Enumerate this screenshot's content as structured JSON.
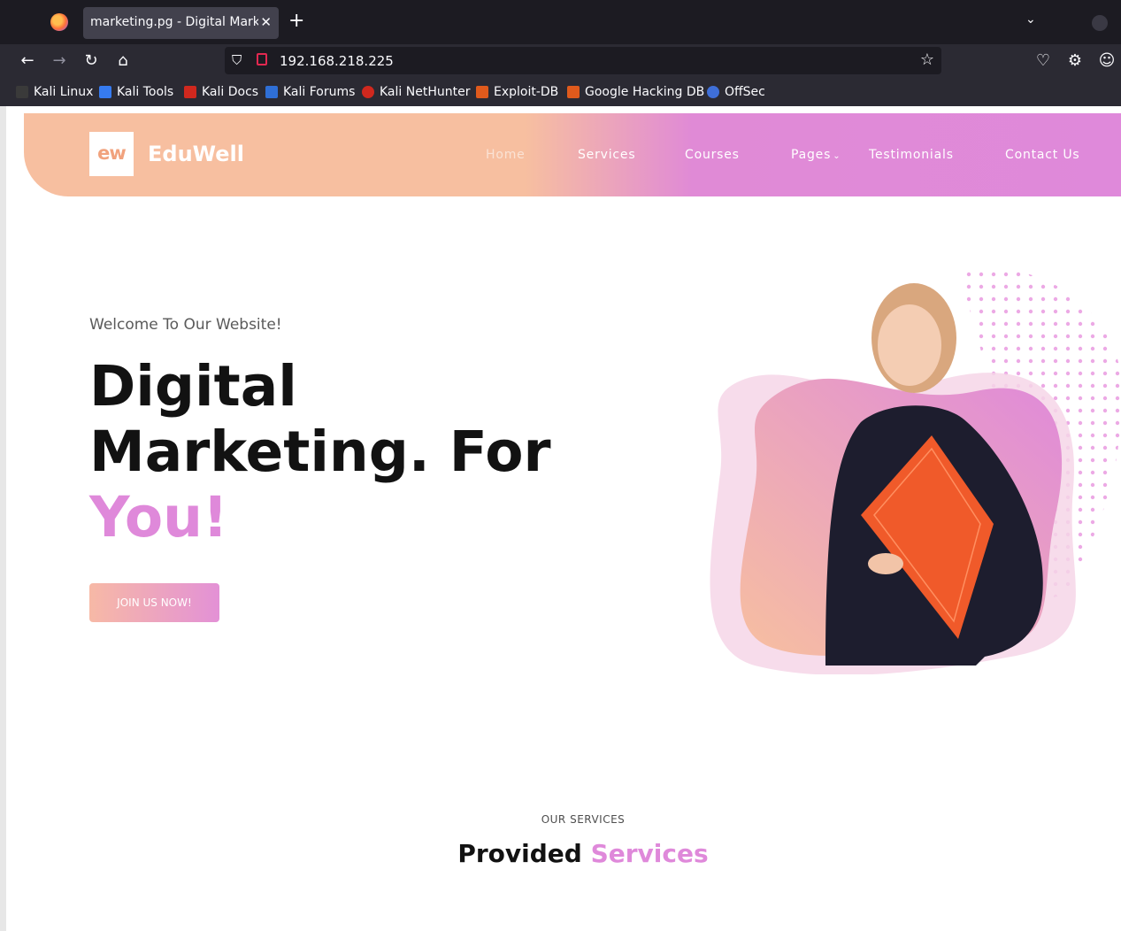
{
  "browser": {
    "tab_title": "marketing.pg - Digital Marketing",
    "new_tab_label": "+",
    "url": "192.168.218.225",
    "bookmarks": [
      {
        "label": "Kali Linux",
        "icon": "kali-dragon-icon"
      },
      {
        "label": "Kali Tools",
        "icon": "kali-tools-icon"
      },
      {
        "label": "Kali Docs",
        "icon": "kali-docs-icon"
      },
      {
        "label": "Kali Forums",
        "icon": "kali-forums-icon"
      },
      {
        "label": "Kali NetHunter",
        "icon": "nethunter-icon"
      },
      {
        "label": "Exploit-DB",
        "icon": "exploit-db-icon"
      },
      {
        "label": "Google Hacking DB",
        "icon": "ghdb-icon"
      },
      {
        "label": "OffSec",
        "icon": "offsec-icon"
      }
    ]
  },
  "site": {
    "logo_mark": "ew",
    "brand": "EduWell",
    "menu": [
      "Home",
      "Services",
      "Courses",
      "Pages",
      "Testimonials",
      "Contact Us"
    ],
    "hero": {
      "welcome": "Welcome To Our Website!",
      "title_line1": "Digital",
      "title_line2": "Marketing. For",
      "title_accent": "You!",
      "cta": "JOIN US NOW!"
    },
    "services": {
      "small_heading": "OUR SERVICES",
      "title_plain": "Provided",
      "title_accent": "Services"
    }
  },
  "colors": {
    "accent_pink": "#df89da",
    "accent_peach": "#f7bfa0",
    "browser_dark": "#1c1b22"
  }
}
